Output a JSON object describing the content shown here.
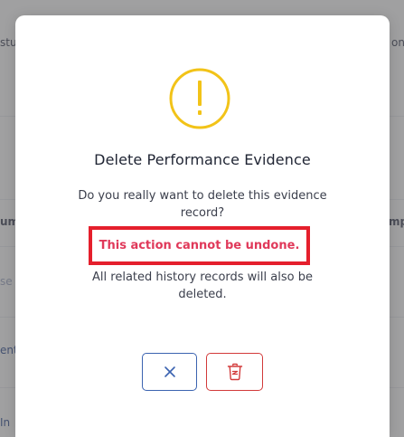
{
  "background": {
    "fragments": {
      "top_left": "stu",
      "top_right": "on",
      "mid_left": "um",
      "mid_right": "mp",
      "row1_left": "se",
      "row2_left": "ent",
      "bottom_left": "In"
    }
  },
  "dialog": {
    "icon": "exclamation-circle-icon",
    "title": "Delete Performance Evidence",
    "question": "Do you really want to delete this evidence record?",
    "warning": "This action cannot be undone.",
    "note": "All related history records will also be deleted.",
    "cancel_icon": "close-icon",
    "delete_icon": "trash-icon"
  },
  "colors": {
    "warning_icon": "#f2c318",
    "warning_text": "#e0395a",
    "highlight_border": "#e51f2c",
    "cancel_accent": "#3b63b0",
    "delete_accent": "#d23a3a"
  }
}
